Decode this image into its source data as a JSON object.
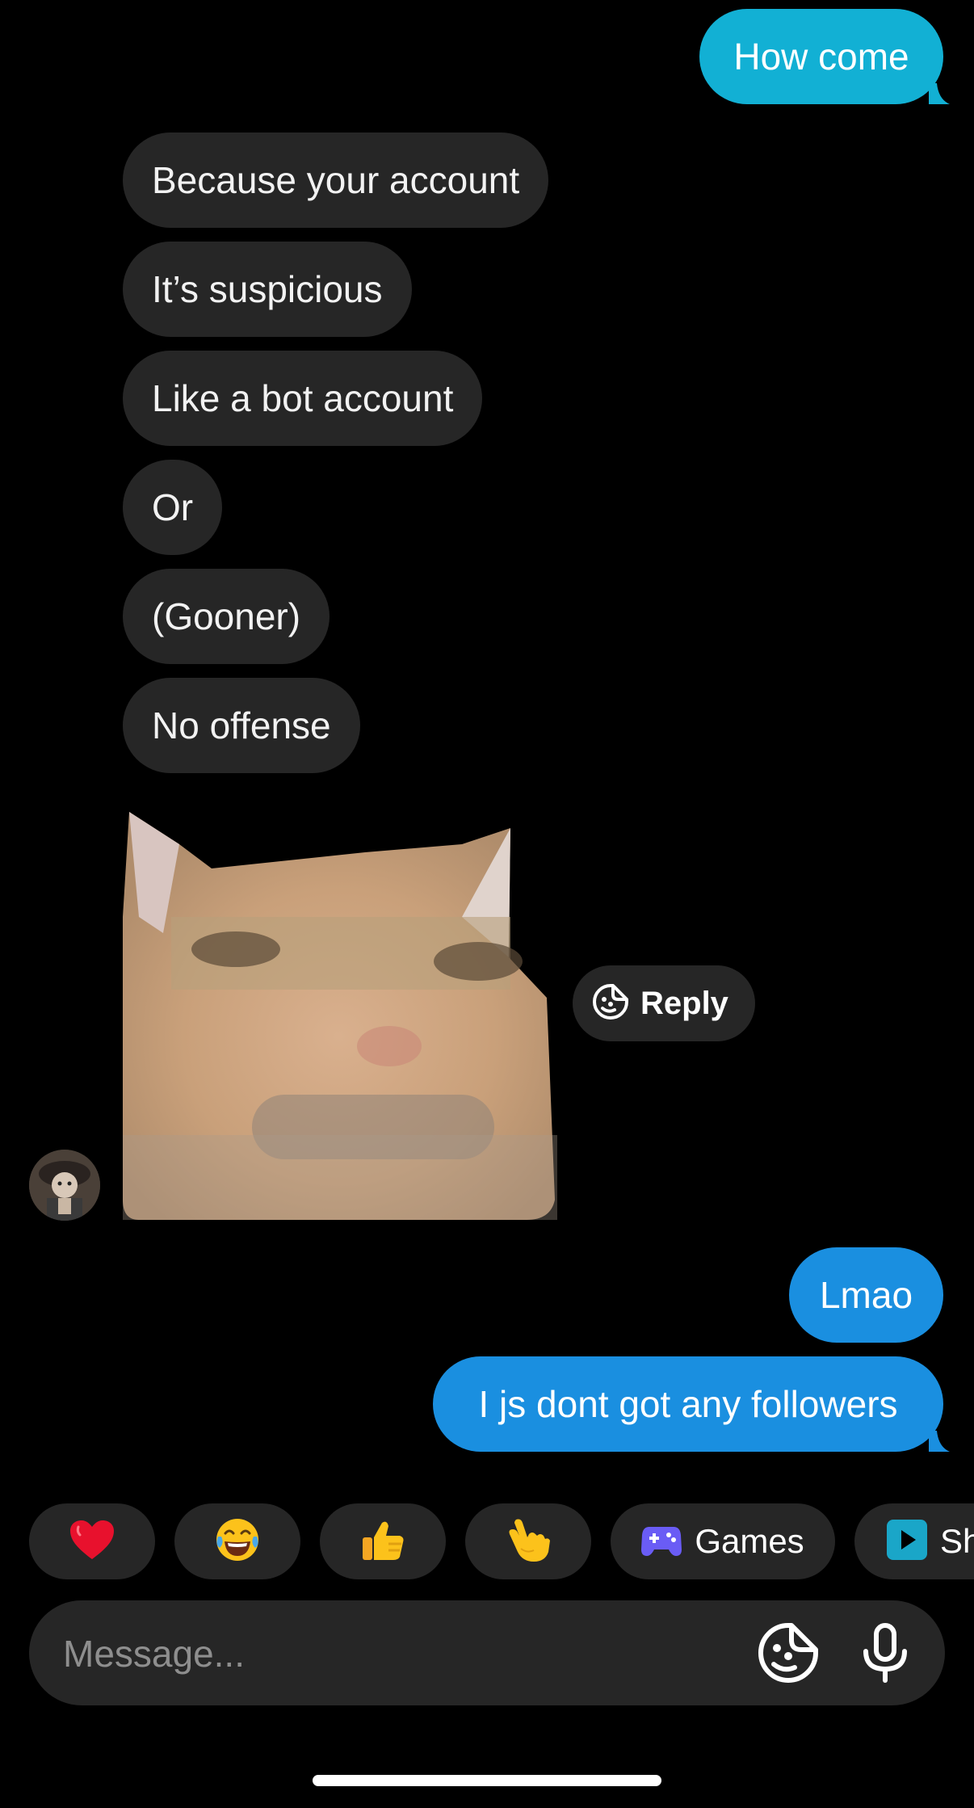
{
  "messages": {
    "sent_top": "How come",
    "received": [
      "Because your account",
      "It’s suspicious",
      "Like a bot account",
      "Or",
      "(Gooner)",
      "No offense"
    ],
    "sent_bottom": [
      "Lmao",
      "I js dont got any followers"
    ]
  },
  "sticker": {
    "reply_label": "Reply"
  },
  "quick_replies": [
    {
      "icon": "red-heart",
      "emoji": "❤️"
    },
    {
      "icon": "laughing-tears",
      "emoji": "😂"
    },
    {
      "icon": "thumbs-up",
      "emoji": "👍"
    },
    {
      "icon": "pointing-hand",
      "emoji": "👆"
    },
    {
      "icon": "gamepad-icon",
      "label": "Games"
    },
    {
      "icon": "play-icon",
      "label": "Sh"
    }
  ],
  "composer": {
    "placeholder": "Message..."
  },
  "colors": {
    "sent_top": "#12b0d4",
    "sent_bottom": "#1a8fe0",
    "received": "#262626",
    "background": "#000000"
  }
}
